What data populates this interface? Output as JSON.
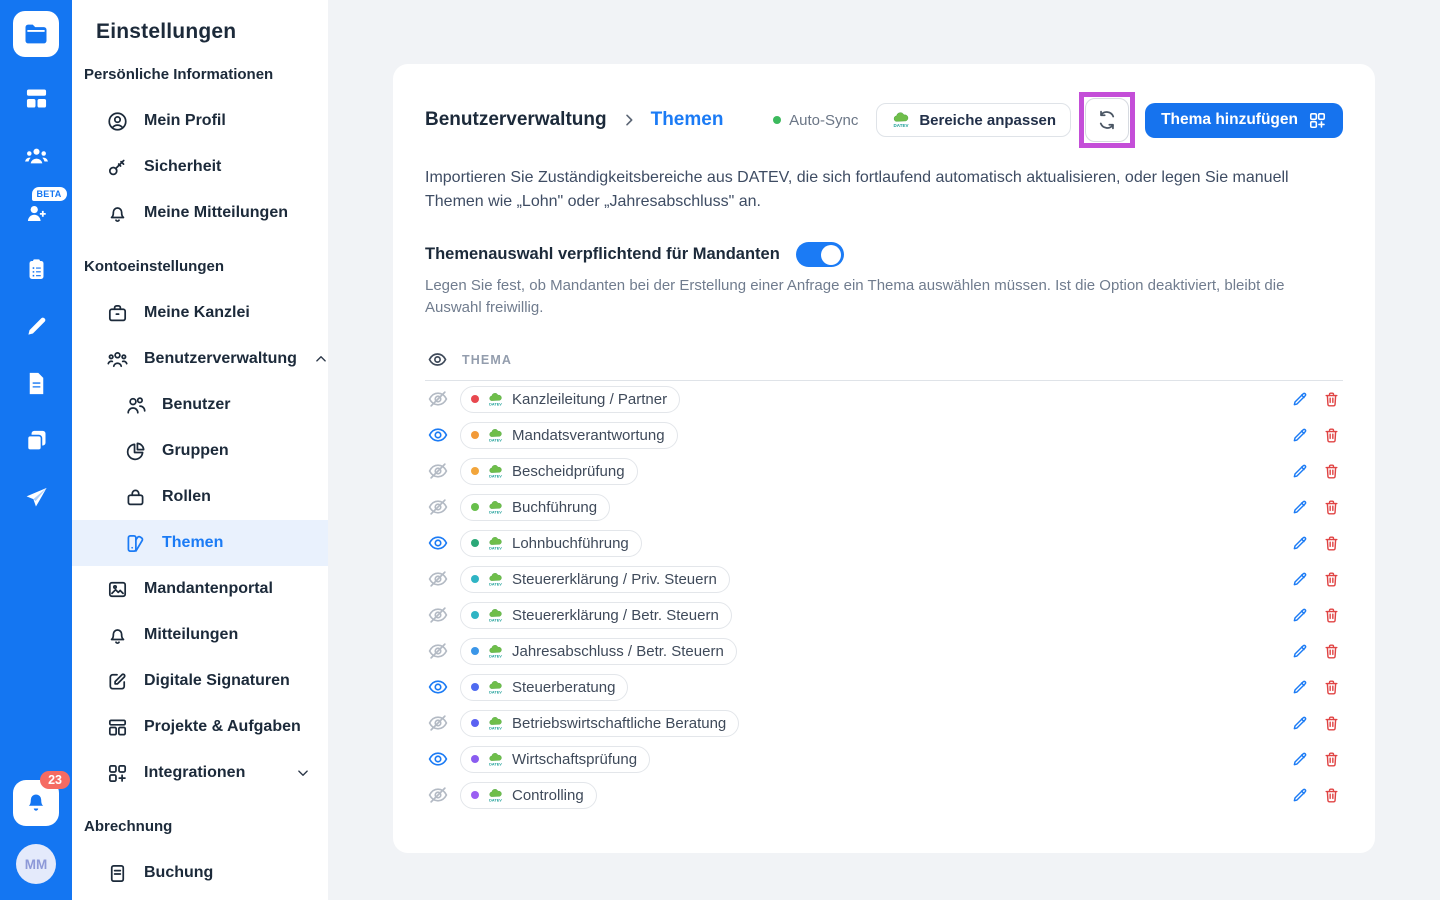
{
  "colors": {
    "rail_blue": "#1476f2",
    "link_blue": "#1b7bf5",
    "button_blue": "#1673ee",
    "highlight_magenta": "#c44ed8",
    "autosync_green": "#3cba5d",
    "delete_red": "#e04444"
  },
  "rail": {
    "items": [
      {
        "icon": "dashboard"
      },
      {
        "icon": "team"
      },
      {
        "icon": "assistant",
        "badge": "BETA"
      },
      {
        "icon": "tasks"
      },
      {
        "icon": "editor"
      },
      {
        "icon": "documents"
      },
      {
        "icon": "templates"
      },
      {
        "icon": "send"
      }
    ],
    "notification_count": "23",
    "avatar_initials": "MM"
  },
  "sidebar": {
    "title": "Einstellungen",
    "sections": [
      {
        "label": "Persönliche Informationen",
        "items": [
          {
            "label": "Mein Profil",
            "icon": "user-circle"
          },
          {
            "label": "Sicherheit",
            "icon": "key"
          },
          {
            "label": "Meine Mitteilungen",
            "icon": "bell"
          }
        ]
      },
      {
        "label": "Kontoeinstellungen",
        "items": [
          {
            "label": "Meine Kanzlei",
            "icon": "briefcase"
          },
          {
            "label": "Benutzerverwaltung",
            "icon": "users-three",
            "chevron": "up"
          },
          {
            "label": "Benutzer",
            "icon": "users-two",
            "sub": true
          },
          {
            "label": "Gruppen",
            "icon": "pie-chart",
            "sub": true
          },
          {
            "label": "Rollen",
            "icon": "bag",
            "sub": true
          },
          {
            "label": "Themen",
            "icon": "swatchbook",
            "sub": true,
            "active": true
          },
          {
            "label": "Mandantenportal",
            "icon": "image"
          },
          {
            "label": "Mitteilungen",
            "icon": "bell"
          },
          {
            "label": "Digitale Signaturen",
            "icon": "edit-square"
          },
          {
            "label": "Projekte & Aufgaben",
            "icon": "kanban"
          },
          {
            "label": "Integrationen",
            "icon": "grid-plus",
            "chevron": "down"
          }
        ]
      },
      {
        "label": "Abrechnung",
        "items": [
          {
            "label": "Buchung",
            "icon": "receipt"
          }
        ]
      }
    ]
  },
  "main": {
    "breadcrumb": {
      "parent": "Benutzerverwaltung",
      "current": "Themen"
    },
    "autosync_label": "Auto-Sync",
    "adjust_button_label": "Bereiche anpassen",
    "add_button_label": "Thema hinzufügen",
    "description": "Importieren Sie Zuständigkeitsbereiche aus DATEV, die sich fortlaufend automatisch aktualisieren, oder legen Sie manuell Themen wie „Lohn\" oder „Jahresabschluss\" an.",
    "toggle": {
      "label": "Themenauswahl verpflichtend für Mandanten",
      "state": "on",
      "description": "Legen Sie fest, ob Mandanten bei der Erstellung einer Anfrage ein Thema auswählen müssen. Ist die Option deaktiviert, bleibt die Auswahl freiwillig."
    },
    "table": {
      "header": "THEMA",
      "rows": [
        {
          "label": "Kanzleileitung / Partner",
          "dot_color": "#e8484f",
          "visible": false
        },
        {
          "label": "Mandatsverantwortung",
          "dot_color": "#f29a38",
          "visible": true
        },
        {
          "label": "Bescheidprüfung",
          "dot_color": "#f2a53b",
          "visible": false
        },
        {
          "label": "Buchführung",
          "dot_color": "#67bf4b",
          "visible": false
        },
        {
          "label": "Lohnbuchführung",
          "dot_color": "#2ba878",
          "visible": true
        },
        {
          "label": "Steuererklärung / Priv. Steuern",
          "dot_color": "#2fb4c4",
          "visible": false
        },
        {
          "label": "Steuererklärung / Betr. Steuern",
          "dot_color": "#2fb4c4",
          "visible": false
        },
        {
          "label": "Jahresabschluss / Betr. Steuern",
          "dot_color": "#3b96e8",
          "visible": false
        },
        {
          "label": "Steuerberatung",
          "dot_color": "#4f6bf0",
          "visible": true
        },
        {
          "label": "Betriebswirtschaftliche Beratung",
          "dot_color": "#5a61f2",
          "visible": false
        },
        {
          "label": "Wirtschaftsprüfung",
          "dot_color": "#8a5cf0",
          "visible": true
        },
        {
          "label": "Controlling",
          "dot_color": "#9b5ff2",
          "visible": false
        }
      ]
    }
  }
}
